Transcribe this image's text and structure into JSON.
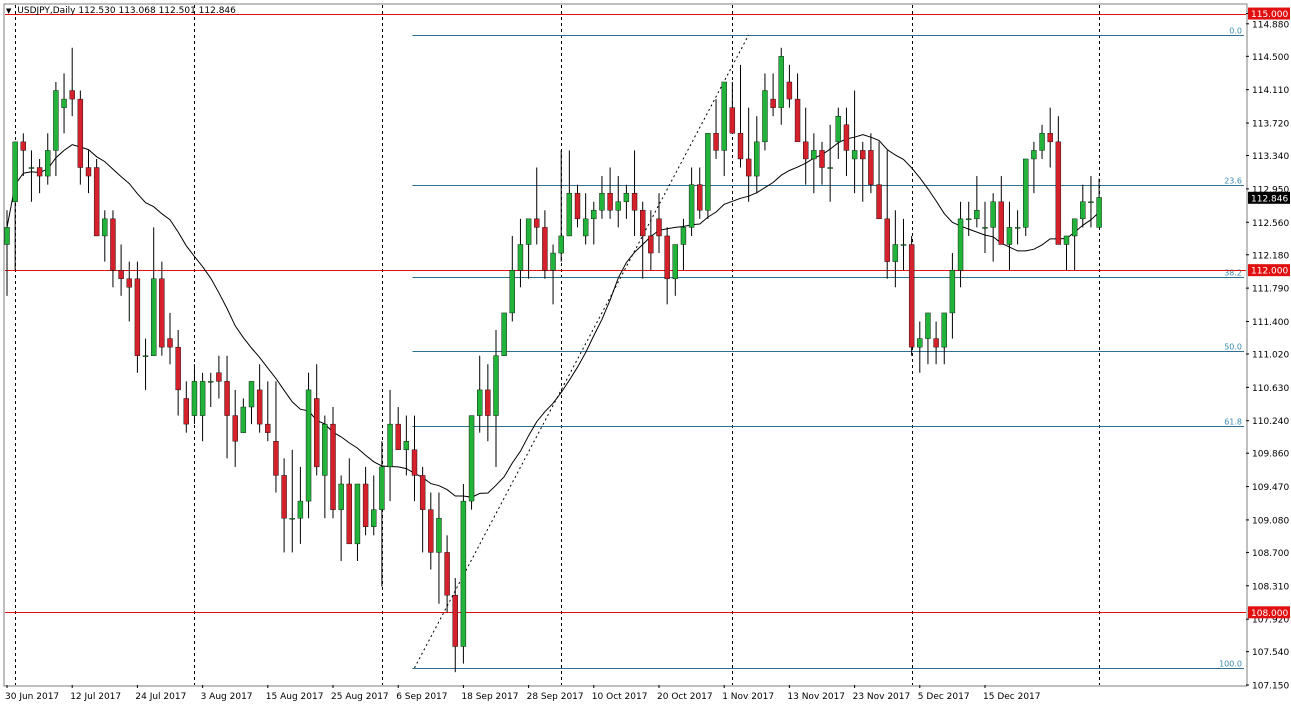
{
  "header": {
    "symbol": "USDJPY,Daily",
    "open": "112.530",
    "high": "113.068",
    "low": "112.501",
    "close": "112.846",
    "arrow_icon": "triangle-down-icon"
  },
  "colors": {
    "background": "#ffffff",
    "bull": "#22b33a",
    "bear": "#d4212b",
    "wick": "#000000",
    "sr_line": "#e01010",
    "fib_line": "#2f6f8f",
    "fib_text": "#3a8ab0",
    "ma_line": "#000000",
    "price_label_bg": "#000000",
    "sr_label_bg": "#e01010"
  },
  "chart_data": {
    "type": "candlestick",
    "symbol": "USDJPY",
    "timeframe": "Daily",
    "ylim": [
      107.15,
      115.1
    ],
    "y_ticks": [
      "115.000",
      "114.880",
      "114.500",
      "114.110",
      "113.720",
      "113.340",
      "112.950",
      "112.560",
      "112.180",
      "111.790",
      "111.400",
      "111.020",
      "110.630",
      "110.240",
      "109.860",
      "109.470",
      "109.080",
      "108.700",
      "108.310",
      "107.920",
      "107.540",
      "107.150"
    ],
    "x_labels": [
      "30 Jun 2017",
      "12 Jul 2017",
      "24 Jul 2017",
      "3 Aug 2017",
      "15 Aug 2017",
      "25 Aug 2017",
      "6 Sep 2017",
      "18 Sep 2017",
      "28 Sep 2017",
      "10 Oct 2017",
      "20 Oct 2017",
      "1 Nov 2017",
      "13 Nov 2017",
      "23 Nov 2017",
      "5 Dec 2017",
      "15 Dec 2017"
    ],
    "x_label_index": [
      0,
      8,
      16,
      24,
      32,
      40,
      48,
      56,
      64,
      72,
      80,
      88,
      96,
      104,
      112,
      120
    ],
    "period_separators": [
      1,
      23,
      46,
      68,
      89,
      111,
      134
    ],
    "current_price": "112.846",
    "horizontal_levels": [
      {
        "value": 115.0,
        "label": "115.000"
      },
      {
        "value": 112.0,
        "label": "112.000"
      },
      {
        "value": 108.0,
        "label": "108.000"
      }
    ],
    "fibonacci": {
      "anchor_low": {
        "index": 50,
        "price": 107.35
      },
      "anchor_high": {
        "index": 91,
        "price": 114.75
      },
      "levels": [
        {
          "ratio": "0.0",
          "price": 114.75
        },
        {
          "ratio": "23.6",
          "price": 113.0
        },
        {
          "ratio": "38.2",
          "price": 111.92
        },
        {
          "ratio": "50.0",
          "price": 111.05
        },
        {
          "ratio": "61.8",
          "price": 110.18
        },
        {
          "ratio": "100.0",
          "price": 107.35
        }
      ]
    },
    "candles": [
      [
        112.3,
        112.7,
        111.7,
        112.5
      ],
      [
        112.8,
        113.5,
        112.0,
        113.5
      ],
      [
        113.5,
        113.6,
        113.1,
        113.4
      ],
      [
        113.2,
        113.4,
        112.8,
        113.2
      ],
      [
        113.2,
        113.3,
        112.9,
        113.1
      ],
      [
        113.1,
        113.6,
        113.0,
        113.4
      ],
      [
        113.4,
        114.2,
        113.1,
        114.1
      ],
      [
        113.9,
        114.3,
        113.6,
        114.0
      ],
      [
        114.1,
        114.6,
        113.8,
        114.0
      ],
      [
        114.0,
        114.1,
        113.0,
        113.2
      ],
      [
        113.2,
        113.4,
        112.9,
        113.1
      ],
      [
        113.2,
        113.3,
        112.5,
        112.4
      ],
      [
        112.4,
        112.7,
        112.1,
        112.6
      ],
      [
        112.6,
        112.7,
        111.8,
        112.0
      ],
      [
        112.0,
        112.3,
        111.7,
        111.9
      ],
      [
        111.9,
        112.1,
        111.4,
        111.8
      ],
      [
        111.9,
        112.1,
        110.8,
        111.0
      ],
      [
        111.0,
        111.2,
        110.6,
        111.0
      ],
      [
        111.0,
        112.5,
        111.0,
        111.9
      ],
      [
        111.9,
        112.1,
        111.0,
        111.1
      ],
      [
        111.2,
        111.5,
        110.9,
        111.1
      ],
      [
        111.1,
        111.3,
        110.3,
        110.6
      ],
      [
        110.5,
        110.7,
        110.1,
        110.2
      ],
      [
        110.3,
        110.9,
        110.2,
        110.7
      ],
      [
        110.3,
        110.8,
        110.0,
        110.7
      ],
      [
        110.7,
        110.8,
        110.4,
        110.7
      ],
      [
        110.8,
        111.0,
        110.5,
        110.7
      ],
      [
        110.7,
        111.0,
        109.8,
        110.3
      ],
      [
        110.3,
        110.6,
        109.7,
        110.0
      ],
      [
        110.1,
        110.5,
        110.1,
        110.4
      ],
      [
        110.4,
        110.7,
        110.2,
        110.7
      ],
      [
        110.6,
        110.9,
        110.1,
        110.2
      ],
      [
        110.2,
        110.7,
        110.0,
        110.1
      ],
      [
        110.0,
        110.7,
        109.4,
        109.6
      ],
      [
        109.6,
        109.8,
        108.7,
        109.1
      ],
      [
        109.1,
        109.9,
        108.7,
        109.1
      ],
      [
        109.1,
        109.7,
        108.8,
        109.3
      ],
      [
        109.3,
        110.8,
        109.1,
        110.6
      ],
      [
        110.5,
        110.9,
        109.6,
        109.7
      ],
      [
        109.6,
        110.3,
        109.1,
        110.2
      ],
      [
        110.2,
        110.4,
        109.1,
        109.2
      ],
      [
        109.2,
        109.6,
        108.6,
        109.5
      ],
      [
        109.5,
        109.8,
        108.8,
        108.8
      ],
      [
        108.8,
        109.5,
        108.6,
        109.5
      ],
      [
        109.5,
        109.7,
        108.9,
        109.0
      ],
      [
        109.0,
        109.6,
        108.9,
        109.2
      ],
      [
        109.2,
        110.0,
        108.3,
        109.7
      ],
      [
        109.7,
        110.6,
        109.3,
        110.2
      ],
      [
        110.2,
        110.4,
        109.9,
        109.9
      ],
      [
        109.9,
        110.3,
        109.6,
        110.0
      ],
      [
        109.9,
        110.3,
        109.3,
        109.6
      ],
      [
        109.6,
        109.7,
        108.7,
        109.2
      ],
      [
        109.2,
        109.4,
        108.5,
        108.7
      ],
      [
        108.7,
        109.4,
        108.1,
        109.1
      ],
      [
        108.7,
        108.9,
        108.0,
        108.2
      ],
      [
        108.2,
        108.4,
        107.3,
        107.6
      ],
      [
        107.6,
        109.5,
        107.4,
        109.3
      ],
      [
        109.3,
        110.3,
        109.2,
        110.3
      ],
      [
        110.3,
        111.0,
        110.1,
        110.6
      ],
      [
        110.6,
        110.9,
        110.0,
        110.3
      ],
      [
        110.3,
        111.3,
        109.7,
        111.0
      ],
      [
        111.0,
        111.5,
        111.0,
        111.5
      ],
      [
        111.5,
        112.4,
        111.4,
        112.0
      ],
      [
        112.0,
        112.6,
        111.8,
        112.3
      ],
      [
        112.3,
        112.5,
        111.9,
        112.6
      ],
      [
        112.6,
        113.2,
        112.3,
        112.5
      ],
      [
        112.5,
        112.7,
        111.9,
        112.0
      ],
      [
        112.0,
        112.3,
        111.6,
        112.2
      ],
      [
        112.2,
        113.4,
        112.1,
        112.4
      ],
      [
        112.4,
        113.4,
        112.4,
        112.9
      ],
      [
        112.9,
        113.0,
        112.5,
        112.6
      ],
      [
        112.4,
        112.9,
        112.3,
        112.6
      ],
      [
        112.6,
        112.8,
        112.3,
        112.7
      ],
      [
        112.7,
        113.1,
        112.6,
        112.9
      ],
      [
        112.9,
        113.2,
        112.6,
        112.7
      ],
      [
        112.7,
        113.1,
        112.5,
        112.8
      ],
      [
        112.8,
        113.0,
        112.6,
        112.9
      ],
      [
        112.9,
        113.4,
        112.4,
        112.7
      ],
      [
        112.7,
        112.8,
        111.9,
        112.4
      ],
      [
        112.4,
        112.7,
        112.0,
        112.2
      ],
      [
        112.6,
        112.9,
        112.2,
        112.4
      ],
      [
        112.4,
        112.5,
        111.6,
        111.9
      ],
      [
        111.9,
        112.3,
        111.7,
        112.3
      ],
      [
        112.3,
        112.6,
        112.0,
        112.5
      ],
      [
        112.5,
        113.2,
        112.4,
        113.0
      ],
      [
        113.0,
        113.2,
        112.6,
        112.7
      ],
      [
        112.7,
        113.6,
        112.6,
        113.6
      ],
      [
        113.6,
        114.0,
        113.3,
        113.4
      ],
      [
        113.4,
        114.2,
        113.1,
        114.2
      ],
      [
        113.9,
        114.2,
        113.6,
        113.6
      ],
      [
        113.6,
        114.4,
        113.2,
        113.3
      ],
      [
        113.3,
        113.9,
        112.8,
        113.1
      ],
      [
        113.1,
        113.8,
        112.9,
        113.5
      ],
      [
        113.5,
        114.3,
        113.4,
        114.1
      ],
      [
        114.0,
        114.3,
        113.8,
        113.9
      ],
      [
        113.9,
        114.6,
        113.7,
        114.5
      ],
      [
        114.2,
        114.4,
        113.9,
        114.0
      ],
      [
        114.0,
        114.3,
        113.7,
        113.5
      ],
      [
        113.5,
        113.9,
        113.0,
        113.3
      ],
      [
        113.3,
        113.6,
        112.9,
        113.4
      ],
      [
        113.4,
        113.5,
        113.0,
        113.2
      ],
      [
        113.2,
        113.7,
        112.8,
        113.2
      ],
      [
        113.5,
        113.9,
        113.3,
        113.8
      ],
      [
        113.7,
        113.9,
        113.1,
        113.4
      ],
      [
        113.3,
        114.1,
        112.9,
        113.4
      ],
      [
        113.4,
        113.5,
        112.8,
        113.3
      ],
      [
        113.4,
        113.6,
        112.9,
        113.0
      ],
      [
        113.0,
        113.5,
        112.6,
        112.6
      ],
      [
        112.6,
        113.4,
        111.9,
        112.1
      ],
      [
        112.1,
        112.7,
        111.8,
        112.3
      ],
      [
        112.3,
        112.6,
        112.0,
        112.3
      ],
      [
        112.3,
        112.4,
        111.0,
        111.1
      ],
      [
        111.1,
        111.4,
        110.8,
        111.2
      ],
      [
        111.2,
        111.5,
        110.9,
        111.5
      ],
      [
        111.2,
        111.4,
        110.9,
        111.1
      ],
      [
        111.1,
        111.5,
        110.9,
        111.5
      ],
      [
        111.5,
        112.2,
        111.2,
        112.0
      ],
      [
        112.0,
        112.8,
        111.8,
        112.6
      ],
      [
        112.6,
        112.8,
        112.4,
        112.6
      ],
      [
        112.6,
        113.1,
        112.5,
        112.7
      ],
      [
        112.5,
        112.8,
        112.2,
        112.5
      ],
      [
        112.5,
        112.9,
        112.1,
        112.8
      ],
      [
        112.8,
        113.1,
        112.3,
        112.3
      ],
      [
        112.3,
        112.8,
        112.0,
        112.5
      ],
      [
        112.5,
        112.7,
        112.3,
        112.5
      ],
      [
        112.5,
        113.3,
        112.4,
        113.3
      ],
      [
        113.3,
        113.5,
        112.9,
        113.4
      ],
      [
        113.4,
        113.7,
        113.3,
        113.6
      ],
      [
        113.6,
        113.9,
        113.2,
        113.5
      ],
      [
        113.5,
        113.8,
        112.5,
        112.3
      ],
      [
        112.3,
        112.4,
        112.0,
        112.4
      ],
      [
        112.4,
        112.6,
        112.0,
        112.6
      ],
      [
        112.6,
        113.0,
        112.5,
        112.8
      ],
      [
        112.8,
        113.1,
        112.5,
        112.8
      ],
      [
        112.5,
        113.07,
        112.5,
        112.85
      ]
    ]
  }
}
